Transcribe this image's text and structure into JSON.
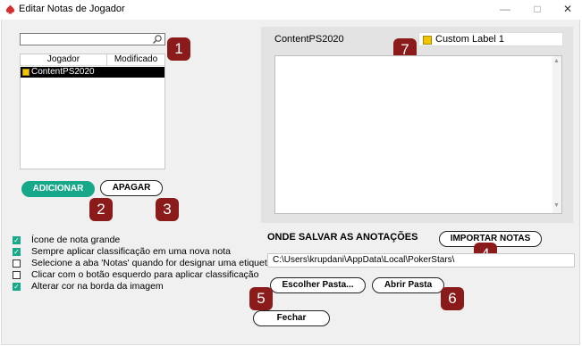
{
  "window": {
    "title": "Editar Notas de Jogador",
    "controls": [
      "minimize-icon",
      "maximize-icon",
      "close-icon"
    ]
  },
  "player_list": {
    "search_placeholder": "",
    "columns": [
      "Jogador",
      "Modificado"
    ],
    "rows": [
      {
        "name": "ContentPS2020",
        "modified": "",
        "label_color": "#f2c400"
      }
    ]
  },
  "buttons": {
    "add": "ADICIONAR",
    "delete": "APAGAR",
    "import": "IMPORTAR NOTAS",
    "choose_folder": "Escolher Pasta...",
    "open_folder": "Abrir Pasta",
    "close": "Fechar"
  },
  "options": [
    {
      "label": "Ícone de nota grande",
      "checked": true
    },
    {
      "label": "Sempre aplicar classificação em uma nova nota",
      "checked": true
    },
    {
      "label": "Selecione a aba 'Notas' quando for designar uma etiqueta",
      "checked": false
    },
    {
      "label": "Clicar com o botão esquerdo para aplicar classificação",
      "checked": false
    },
    {
      "label": "Alterar cor na borda da imagem",
      "checked": true
    }
  ],
  "notes_panel": {
    "player_name": "ContentPS2020",
    "label": "Custom Label 1",
    "label_color": "#f2c400",
    "note_text": ""
  },
  "save_location": {
    "heading": "ONDE SALVAR AS ANOTAÇÕES",
    "path": "C:\\Users\\krupdani\\AppData\\Local\\PokerStars\\"
  },
  "badges": [
    "1",
    "2",
    "3",
    "4",
    "5",
    "6",
    "7"
  ],
  "colors": {
    "accent_green": "#17a88a",
    "badge_red": "#8b1a1a",
    "app_red": "#d32f2f"
  }
}
